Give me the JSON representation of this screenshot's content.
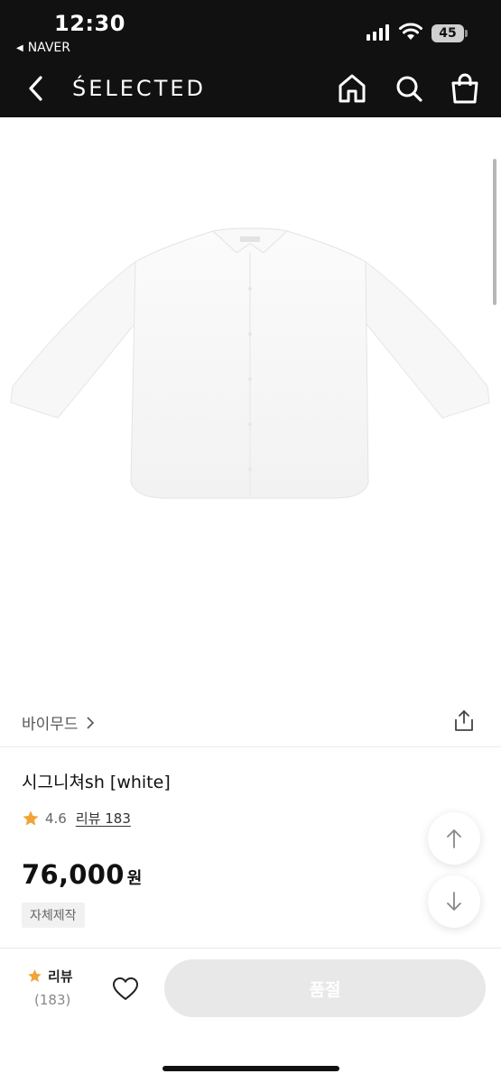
{
  "status_bar": {
    "time": "12:30",
    "back_app_label": "NAVER",
    "battery": "45"
  },
  "nav": {
    "brand": "ŚELECTED",
    "icons": [
      "chevron-left-icon",
      "home-icon",
      "search-icon",
      "shopping-bag-icon"
    ]
  },
  "product": {
    "image_alt": "white shirt",
    "brand_name": "바이무드",
    "title": "시그니쳐sh [white]",
    "rating": "4.6",
    "review_link": "리뷰 183",
    "price": "76,000",
    "price_unit": "원",
    "badge": "자체제작"
  },
  "bottom_bar": {
    "review_label": "리뷰",
    "review_count": "(183)",
    "buy_button": "품절"
  },
  "colors": {
    "header_bg": "#111111",
    "star": "#f2a33a",
    "button_disabled_bg": "#e8e8e8"
  }
}
